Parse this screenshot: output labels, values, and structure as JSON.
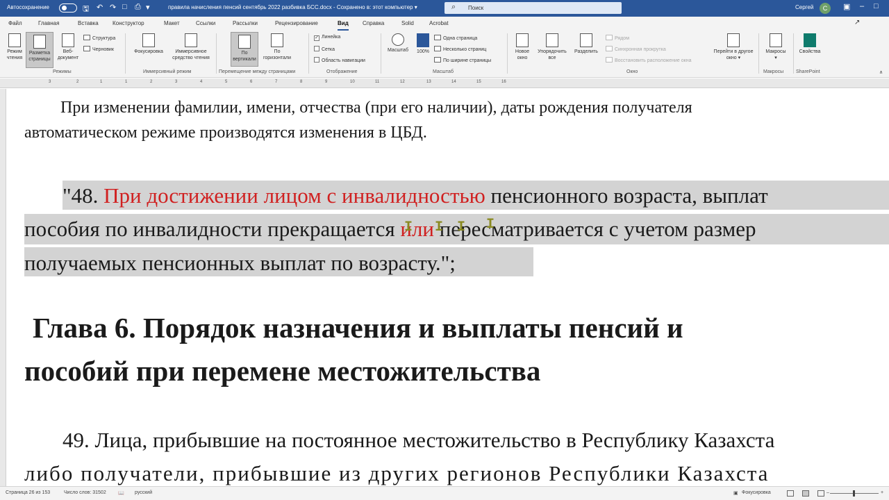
{
  "titlebar": {
    "autosave_label": "Автосохранение",
    "document_title": "правила начисления пенсий сентябрь 2022  разбивка БСС.docx  -  Сохранено в: этот компьютер  ▾",
    "search_placeholder": "Поиск",
    "user_name": "Сергей",
    "user_initial": "С",
    "accent_color": "#2b579a"
  },
  "tabs": [
    "Файл",
    "Главная",
    "Вставка",
    "Конструктор",
    "Макет",
    "Ссылки",
    "Рассылки",
    "Рецензирование",
    "Вид",
    "Справка",
    "Solid",
    "Acrobat"
  ],
  "active_tab": "Вид",
  "ribbon": {
    "modes": {
      "read_mode": "Режим чтения",
      "print_layout": "Разметка страницы",
      "web_layout": "Веб-документ",
      "outline": "Структура",
      "draft": "Черновик",
      "group": "Режимы"
    },
    "immersive": {
      "focus": "Фокусировка",
      "immersive_reader": "Иммерсивное средство чтения",
      "group": "Иммерсивный режим"
    },
    "page_movement": {
      "vertical": "По вертикали",
      "horizontal": "По горизонтали",
      "group": "Перемещение между страницами"
    },
    "show": {
      "ruler": "Линейка",
      "gridlines": "Сетка",
      "nav_pane": "Область навигации",
      "group": "Отображение"
    },
    "zoom": {
      "zoom": "Масштаб",
      "hundred": "100%",
      "one_page": "Одна страница",
      "multiple_pages": "Несколько страниц",
      "page_width": "По ширине страницы",
      "group": "Масштаб"
    },
    "window": {
      "new_window": "Новое окно",
      "arrange_all": "Упорядочить все",
      "split": "Разделить",
      "side_by_side": "Рядом",
      "sync_scroll": "Синхронная прокрутка",
      "reset_position": "Восстановить расположение окна",
      "switch_windows": "Перейти в другое окно",
      "group": "Окно"
    },
    "macros": {
      "label": "Макросы",
      "group": "Макросы"
    },
    "sharepoint": {
      "label": "Свойства",
      "group": "SharePoint"
    }
  },
  "ruler_numbers": [
    "3",
    "2",
    "1",
    "1",
    "2",
    "3",
    "4",
    "5",
    "6",
    "7",
    "8",
    "9",
    "10",
    "11",
    "12",
    "13",
    "14",
    "15",
    "16"
  ],
  "document": {
    "para1_line1": "При изменении фамилии, имени, отчества (при его наличии), даты рождения получателя",
    "para1_line2": "автоматическом режиме производятся изменения в ЦБД.",
    "p48_prefix": "\"48. ",
    "p48_red": "При достижении лицом с инвалидностью",
    "p48_rest": " пенсионного возраста, выплат",
    "p48_line2_a": "пособия по инвалидности прекращается",
    "p48_line2_red": " или",
    "p48_line2_b": " пересматривается с учетом размер",
    "p48_line3": "получаемых пенсионных выплат по возрасту.\";",
    "heading_line1": "Глава 6. Порядок назначения и выплаты пенсий и",
    "heading_line2": "пособий при перемене местожительства",
    "p49_line1": "49. Лица, прибывшие на постоянное местожительство в Республику Казахста",
    "p49_line2": "либо получатели, прибывшие из других регионов Республики Казахста"
  },
  "statusbar": {
    "page": "Страница 26 из 153",
    "words": "Число слов: 31502",
    "language": "русский",
    "focus": "Фокусировка"
  }
}
